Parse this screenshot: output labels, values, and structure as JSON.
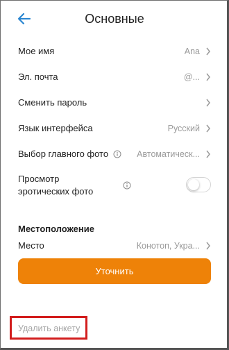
{
  "header": {
    "title": "Основные",
    "back_icon": "arrow-left-icon",
    "accent": "#2b86d1"
  },
  "settings": [
    {
      "label": "Мое имя",
      "value": "Ana"
    },
    {
      "label": "Эл. почта",
      "value": "@..."
    },
    {
      "label": "Сменить пароль",
      "value": ""
    },
    {
      "label": "Язык интерфейса",
      "value": "Русский"
    },
    {
      "label": "Выбор главного фото",
      "value": "Автоматическ..."
    }
  ],
  "erotic_toggle": {
    "label": "Просмотр эротических фото",
    "enabled": false
  },
  "location": {
    "section_title": "Местоположение",
    "place_label": "Место",
    "place_value": "Конотоп, Укра...",
    "refine_button": "Уточнить",
    "button_color": "#ee8208"
  },
  "delete": {
    "label": "Удалить анкету",
    "highlight_color": "#d21d1d"
  }
}
